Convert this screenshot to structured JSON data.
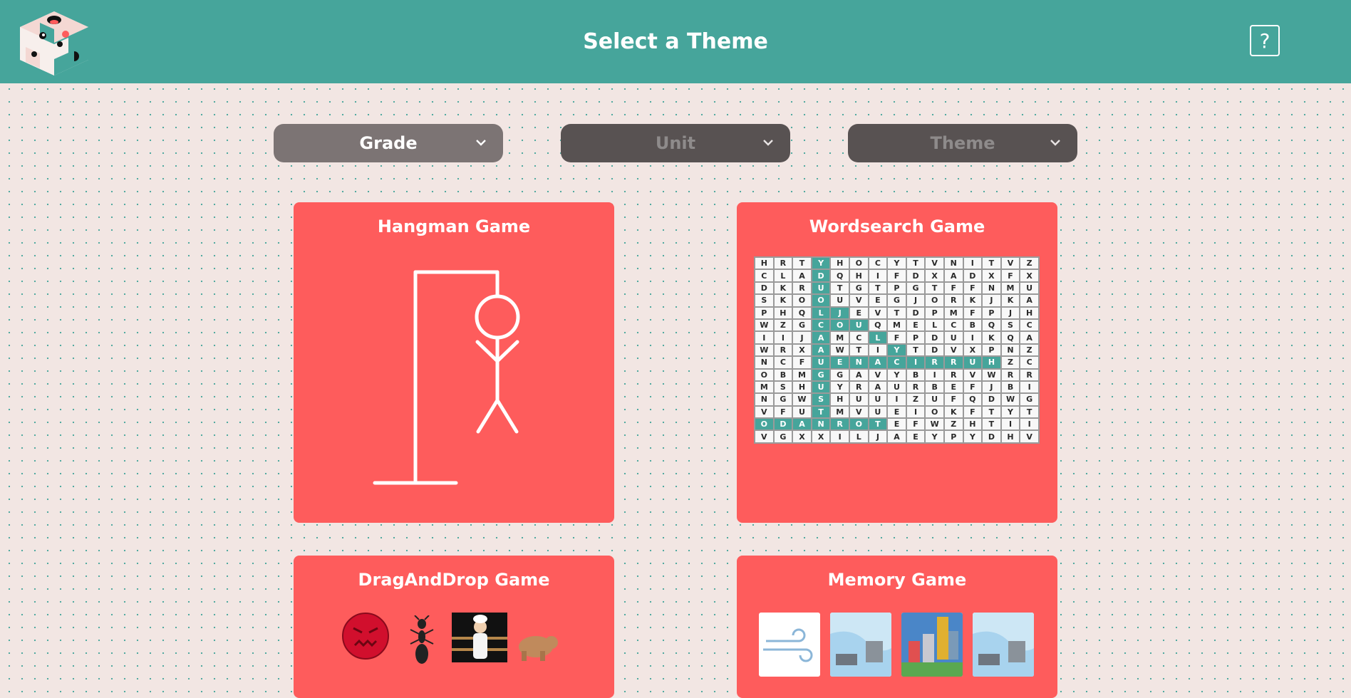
{
  "header": {
    "title": "Select a Theme",
    "help_label": "?"
  },
  "filters": {
    "grade_label": "Grade",
    "unit_label": "Unit",
    "theme_label": "Theme"
  },
  "games": [
    {
      "title": "Hangman Game"
    },
    {
      "title": "Wordsearch Game"
    },
    {
      "title": "DragAndDrop Game"
    },
    {
      "title": "Memory Game"
    }
  ],
  "wordsearch": {
    "rows": [
      "HRTYHOCYTVNITVZ",
      "CLADQHIFDXADXFX",
      "DKRUTGTPGTFFNMU",
      "SKOOUVEGJORKJKA",
      "PHQLJEVTDPMFPJH",
      "WZGCOUQMELCBQSC",
      "IIJAMCLFPDUIKQA",
      "WRXAWTIYTDVXPNZ",
      "NCFUENACIRRUHZC",
      "OBMGGAVYBIRVWRR",
      "MSHUYRAURBEFJBI",
      "NGWSHUUIZUFQDWG",
      "VFUTMVUEIOKFTYT",
      "ODANROTEFWZHTII",
      "VGXXILJAEYPYDHV"
    ],
    "highlight_color": "#46a59b"
  },
  "colors": {
    "header_bg": "#46a59b",
    "card_bg": "#fe5c5c",
    "page_bg": "#f2e6e3",
    "dropdown_active": "#7c7474",
    "dropdown_disabled": "#585252"
  },
  "icons": {
    "logo": "hexagon-faces-logo",
    "help": "question-mark-icon",
    "dropdown": "chevron-down-icon"
  }
}
